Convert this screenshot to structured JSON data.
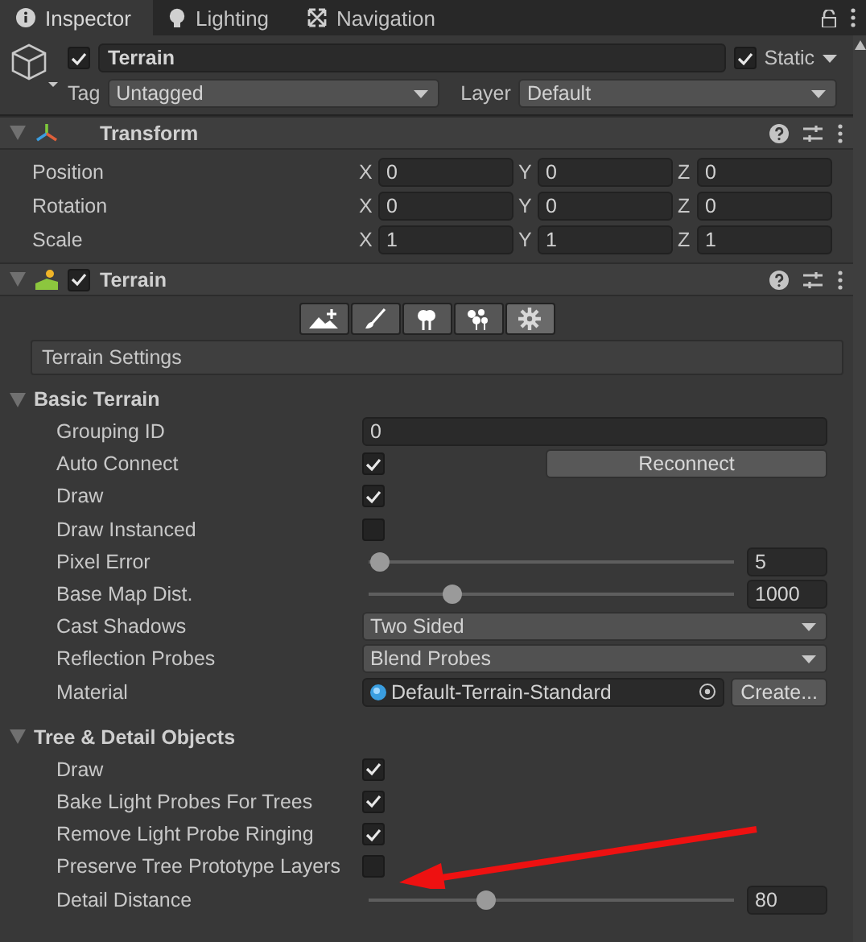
{
  "tabs": [
    {
      "label": "Inspector",
      "selected": true
    },
    {
      "label": "Lighting",
      "selected": false
    },
    {
      "label": "Navigation",
      "selected": false
    }
  ],
  "object": {
    "active": true,
    "name": "Terrain",
    "static": true,
    "static_label": "Static",
    "tag_label": "Tag",
    "tag": "Untagged",
    "layer_label": "Layer",
    "layer": "Default"
  },
  "transform": {
    "title": "Transform",
    "expanded": true,
    "rows": [
      {
        "label": "Position",
        "values": [
          {
            "axis": "X",
            "value": "0"
          },
          {
            "axis": "Y",
            "value": "0"
          },
          {
            "axis": "Z",
            "value": "0"
          }
        ]
      },
      {
        "label": "Rotation",
        "values": [
          {
            "axis": "X",
            "value": "0"
          },
          {
            "axis": "Y",
            "value": "0"
          },
          {
            "axis": "Z",
            "value": "0"
          }
        ]
      },
      {
        "label": "Scale",
        "values": [
          {
            "axis": "X",
            "value": "1"
          },
          {
            "axis": "Y",
            "value": "1"
          },
          {
            "axis": "Z",
            "value": "1"
          }
        ]
      }
    ]
  },
  "terrain": {
    "title": "Terrain",
    "enabled": true,
    "expanded": true,
    "tools": [
      {
        "kind": "raise",
        "selected": false
      },
      {
        "kind": "paint",
        "selected": false
      },
      {
        "kind": "trees",
        "selected": false
      },
      {
        "kind": "details",
        "selected": false
      },
      {
        "kind": "settings",
        "selected": true
      }
    ],
    "settings_title": "Terrain Settings",
    "sections": [
      {
        "title": "Basic Terrain",
        "expanded": true,
        "rows": [
          {
            "kind": "field",
            "label": "Grouping ID",
            "value": "0"
          },
          {
            "kind": "checkbox",
            "label": "Auto Connect",
            "checked": true,
            "button": "Reconnect"
          },
          {
            "kind": "checkbox",
            "label": "Draw",
            "checked": true
          },
          {
            "kind": "checkbox",
            "label": "Draw Instanced",
            "checked": false
          },
          {
            "kind": "slider",
            "label": "Pixel Error",
            "level": 0.03,
            "value": "5"
          },
          {
            "kind": "slider",
            "label": "Base Map Dist.",
            "level": 0.23,
            "value": "1000"
          },
          {
            "kind": "dropdown",
            "label": "Cast Shadows",
            "value": "Two Sided"
          },
          {
            "kind": "dropdown",
            "label": "Reflection Probes",
            "value": "Blend Probes"
          },
          {
            "kind": "object",
            "label": "Material",
            "value": "Default-Terrain-Standard",
            "button": "Create..."
          }
        ]
      },
      {
        "title": "Tree & Detail Objects",
        "expanded": true,
        "rows": [
          {
            "kind": "checkbox",
            "label": "Draw",
            "checked": true
          },
          {
            "kind": "checkbox",
            "label": "Bake Light Probes For Trees",
            "checked": true
          },
          {
            "kind": "checkbox",
            "label": "Remove Light Probe Ringing",
            "checked": true
          },
          {
            "kind": "checkbox",
            "label": "Preserve Tree Prototype Layers",
            "checked": false
          },
          {
            "kind": "slider",
            "label": "Detail Distance",
            "level": 0.32,
            "value": "80"
          }
        ]
      }
    ]
  }
}
